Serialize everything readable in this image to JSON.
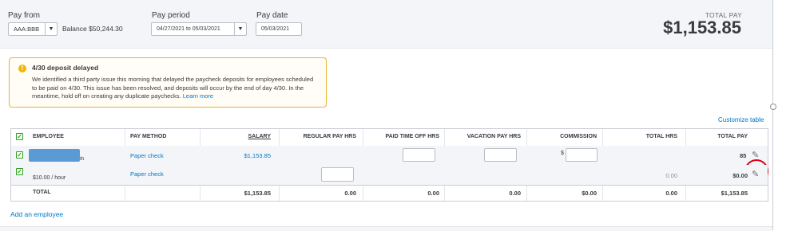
{
  "header": {
    "pay_from_label": "Pay from",
    "pay_from_value": "AAA:BBB",
    "balance": "Balance $50,244.30",
    "pay_period_label": "Pay period",
    "pay_period_value": "04/27/2021 to 05/03/2021",
    "pay_date_label": "Pay date",
    "pay_date_value": "05/03/2021",
    "total_pay_label": "TOTAL PAY",
    "total_pay_amount": "$1,153.85"
  },
  "alert": {
    "title": "4/30 deposit delayed",
    "body": "We identified a third party issue this morning that delayed the paycheck deposits for employees scheduled to be paid on 4/30. This issue has been resolved, and deposits will occur by the end of day 4/30. In the meantime, hold off on creating any duplicate paychecks.",
    "link": "Learn more",
    "icon": "exclamation-icon",
    "color": "#e8b432"
  },
  "customize_table": "Customize table",
  "table": {
    "columns": [
      "EMPLOYEE",
      "PAY METHOD",
      "SALARY",
      "REGULAR PAY HRS",
      "PAID TIME OFF HRS",
      "VACATION PAY HRS",
      "COMMISSION",
      "TOTAL HRS",
      "TOTAL PAY"
    ],
    "rows": [
      {
        "employee_suffix": "th",
        "pay_method": "Paper check",
        "salary": "$1,153.85",
        "commission_prefix": "$",
        "total_hrs": "",
        "total_pay_partial": "85"
      },
      {
        "employee_rate": "$10.00 / hour",
        "pay_method": "Paper check",
        "salary": "",
        "total_hrs": "0.00",
        "total_pay": "$0.00"
      }
    ],
    "total_row": {
      "label": "TOTAL",
      "salary": "$1,153.85",
      "regular": "0.00",
      "pto": "0.00",
      "vacation": "0.00",
      "commission": "$0.00",
      "total_hrs": "0.00",
      "total_pay": "$1,153.85"
    }
  },
  "add_employee": "Add an employee",
  "colors": {
    "link": "#0077c5",
    "check": "#2ca01c",
    "annotation": "#e00013"
  }
}
